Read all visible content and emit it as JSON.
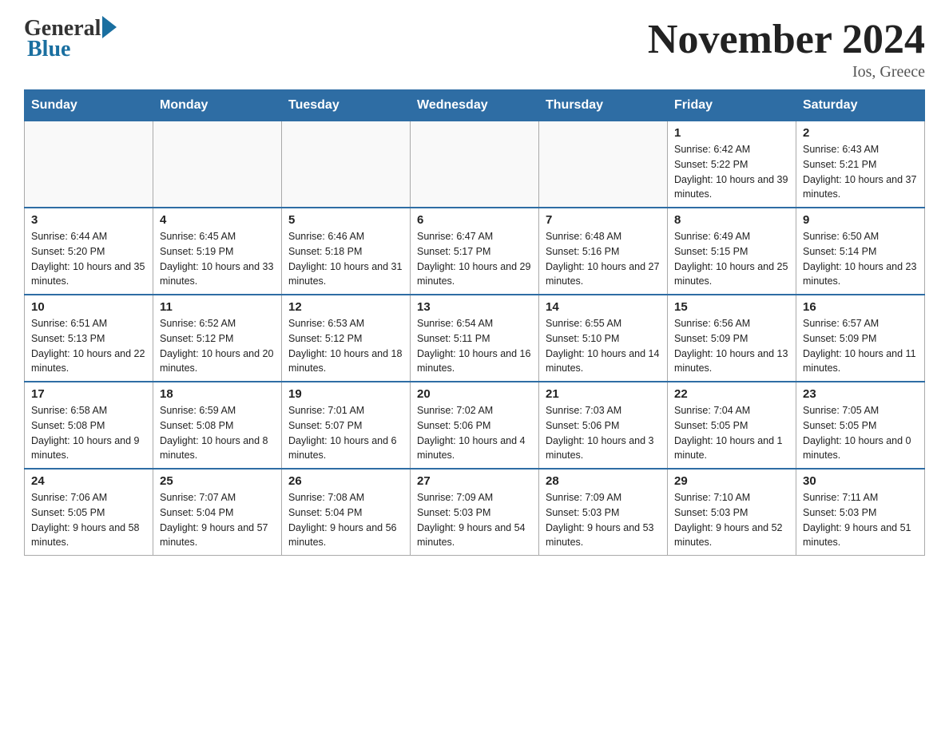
{
  "header": {
    "logo_general": "General",
    "logo_blue": "Blue",
    "month_title": "November 2024",
    "location": "Ios, Greece"
  },
  "weekdays": [
    "Sunday",
    "Monday",
    "Tuesday",
    "Wednesday",
    "Thursday",
    "Friday",
    "Saturday"
  ],
  "weeks": [
    [
      {
        "day": "",
        "info": ""
      },
      {
        "day": "",
        "info": ""
      },
      {
        "day": "",
        "info": ""
      },
      {
        "day": "",
        "info": ""
      },
      {
        "day": "",
        "info": ""
      },
      {
        "day": "1",
        "info": "Sunrise: 6:42 AM\nSunset: 5:22 PM\nDaylight: 10 hours and 39 minutes."
      },
      {
        "day": "2",
        "info": "Sunrise: 6:43 AM\nSunset: 5:21 PM\nDaylight: 10 hours and 37 minutes."
      }
    ],
    [
      {
        "day": "3",
        "info": "Sunrise: 6:44 AM\nSunset: 5:20 PM\nDaylight: 10 hours and 35 minutes."
      },
      {
        "day": "4",
        "info": "Sunrise: 6:45 AM\nSunset: 5:19 PM\nDaylight: 10 hours and 33 minutes."
      },
      {
        "day": "5",
        "info": "Sunrise: 6:46 AM\nSunset: 5:18 PM\nDaylight: 10 hours and 31 minutes."
      },
      {
        "day": "6",
        "info": "Sunrise: 6:47 AM\nSunset: 5:17 PM\nDaylight: 10 hours and 29 minutes."
      },
      {
        "day": "7",
        "info": "Sunrise: 6:48 AM\nSunset: 5:16 PM\nDaylight: 10 hours and 27 minutes."
      },
      {
        "day": "8",
        "info": "Sunrise: 6:49 AM\nSunset: 5:15 PM\nDaylight: 10 hours and 25 minutes."
      },
      {
        "day": "9",
        "info": "Sunrise: 6:50 AM\nSunset: 5:14 PM\nDaylight: 10 hours and 23 minutes."
      }
    ],
    [
      {
        "day": "10",
        "info": "Sunrise: 6:51 AM\nSunset: 5:13 PM\nDaylight: 10 hours and 22 minutes."
      },
      {
        "day": "11",
        "info": "Sunrise: 6:52 AM\nSunset: 5:12 PM\nDaylight: 10 hours and 20 minutes."
      },
      {
        "day": "12",
        "info": "Sunrise: 6:53 AM\nSunset: 5:12 PM\nDaylight: 10 hours and 18 minutes."
      },
      {
        "day": "13",
        "info": "Sunrise: 6:54 AM\nSunset: 5:11 PM\nDaylight: 10 hours and 16 minutes."
      },
      {
        "day": "14",
        "info": "Sunrise: 6:55 AM\nSunset: 5:10 PM\nDaylight: 10 hours and 14 minutes."
      },
      {
        "day": "15",
        "info": "Sunrise: 6:56 AM\nSunset: 5:09 PM\nDaylight: 10 hours and 13 minutes."
      },
      {
        "day": "16",
        "info": "Sunrise: 6:57 AM\nSunset: 5:09 PM\nDaylight: 10 hours and 11 minutes."
      }
    ],
    [
      {
        "day": "17",
        "info": "Sunrise: 6:58 AM\nSunset: 5:08 PM\nDaylight: 10 hours and 9 minutes."
      },
      {
        "day": "18",
        "info": "Sunrise: 6:59 AM\nSunset: 5:08 PM\nDaylight: 10 hours and 8 minutes."
      },
      {
        "day": "19",
        "info": "Sunrise: 7:01 AM\nSunset: 5:07 PM\nDaylight: 10 hours and 6 minutes."
      },
      {
        "day": "20",
        "info": "Sunrise: 7:02 AM\nSunset: 5:06 PM\nDaylight: 10 hours and 4 minutes."
      },
      {
        "day": "21",
        "info": "Sunrise: 7:03 AM\nSunset: 5:06 PM\nDaylight: 10 hours and 3 minutes."
      },
      {
        "day": "22",
        "info": "Sunrise: 7:04 AM\nSunset: 5:05 PM\nDaylight: 10 hours and 1 minute."
      },
      {
        "day": "23",
        "info": "Sunrise: 7:05 AM\nSunset: 5:05 PM\nDaylight: 10 hours and 0 minutes."
      }
    ],
    [
      {
        "day": "24",
        "info": "Sunrise: 7:06 AM\nSunset: 5:05 PM\nDaylight: 9 hours and 58 minutes."
      },
      {
        "day": "25",
        "info": "Sunrise: 7:07 AM\nSunset: 5:04 PM\nDaylight: 9 hours and 57 minutes."
      },
      {
        "day": "26",
        "info": "Sunrise: 7:08 AM\nSunset: 5:04 PM\nDaylight: 9 hours and 56 minutes."
      },
      {
        "day": "27",
        "info": "Sunrise: 7:09 AM\nSunset: 5:03 PM\nDaylight: 9 hours and 54 minutes."
      },
      {
        "day": "28",
        "info": "Sunrise: 7:09 AM\nSunset: 5:03 PM\nDaylight: 9 hours and 53 minutes."
      },
      {
        "day": "29",
        "info": "Sunrise: 7:10 AM\nSunset: 5:03 PM\nDaylight: 9 hours and 52 minutes."
      },
      {
        "day": "30",
        "info": "Sunrise: 7:11 AM\nSunset: 5:03 PM\nDaylight: 9 hours and 51 minutes."
      }
    ]
  ]
}
